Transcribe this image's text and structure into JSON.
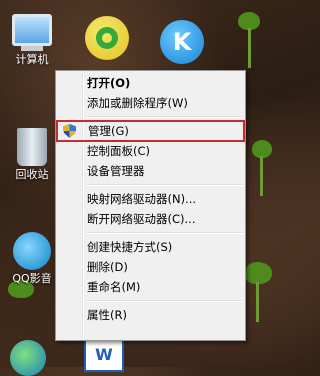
{
  "desktop": {
    "icons": [
      {
        "label": "计算机"
      },
      {
        "label": "回收站"
      },
      {
        "label": "QQ影音"
      }
    ],
    "k_icon_letter": "K",
    "word_icon_letter": "W"
  },
  "context_menu": {
    "items": [
      {
        "label": "打开(O)"
      },
      {
        "label": "添加或删除程序(W)"
      },
      {
        "label": "管理(G)"
      },
      {
        "label": "控制面板(C)"
      },
      {
        "label": "设备管理器"
      },
      {
        "label": "映射网络驱动器(N)..."
      },
      {
        "label": "断开网络驱动器(C)..."
      },
      {
        "label": "创建快捷方式(S)"
      },
      {
        "label": "删除(D)"
      },
      {
        "label": "重命名(M)"
      },
      {
        "label": "属性(R)"
      }
    ],
    "highlight_color": "#c62b31"
  }
}
